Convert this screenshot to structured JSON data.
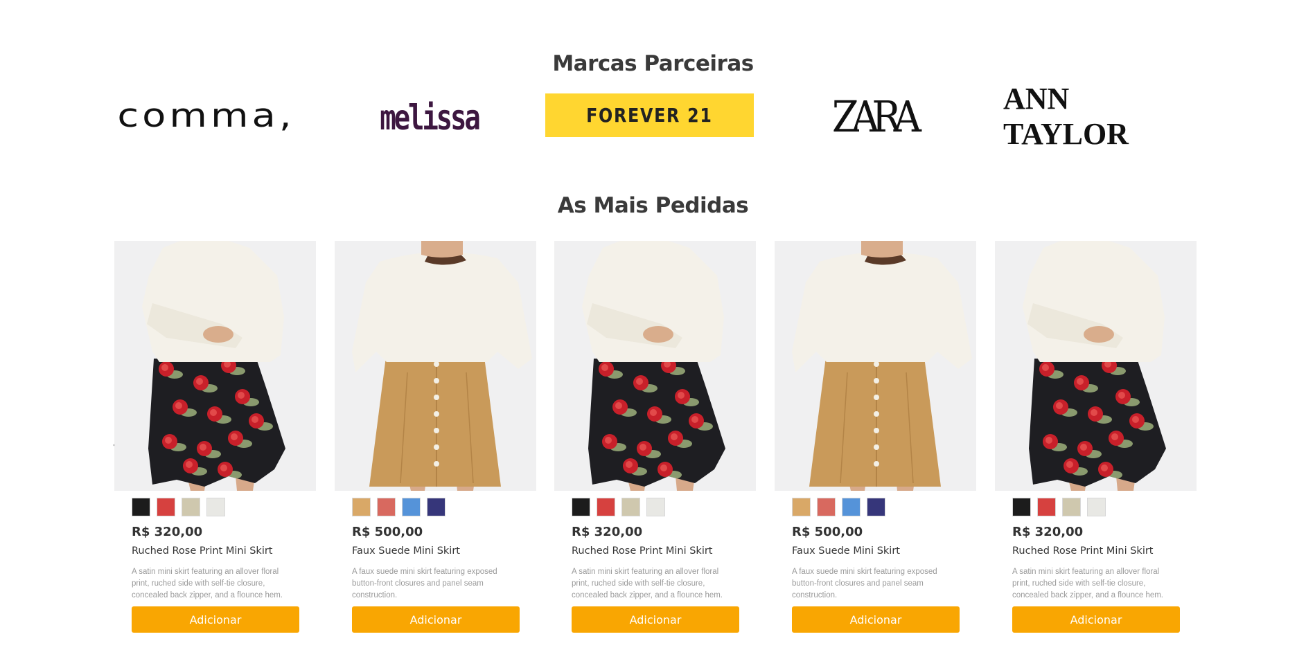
{
  "brands": {
    "title": "Marcas Parceiras",
    "items": [
      "comma,",
      "melissa",
      "FOREVER 21",
      "ZARA",
      "ANN TAYLOR"
    ],
    "forever21_bg": "#ffd630"
  },
  "best_sellers": {
    "title": "As Mais Pedidas",
    "add_label": "Adicionar",
    "accent": "#f9a602",
    "products": [
      {
        "price": "R$ 320,00",
        "name": "Ruched Rose Print Mini Skirt",
        "description": "A satin mini skirt featuring an allover floral print, ruched side with self-tie closure, concealed back zipper, and a flounce hem.",
        "colors": [
          "#1c1c1c",
          "#d6413f",
          "#cfc8ae",
          "#e8e8e4"
        ],
        "skirt": "floral"
      },
      {
        "price": "R$ 500,00",
        "name": "Faux Suede Mini Skirt",
        "description": "A faux suede mini skirt featuring exposed button-front closures and panel seam construction.",
        "colors": [
          "#d9a867",
          "#d8695f",
          "#5593d9",
          "#36367a"
        ],
        "skirt": "suede"
      },
      {
        "price": "R$ 320,00",
        "name": "Ruched Rose Print Mini Skirt",
        "description": "A satin mini skirt featuring an allover floral print, ruched side with self-tie closure, concealed back zipper, and a flounce hem.",
        "colors": [
          "#1c1c1c",
          "#d6413f",
          "#cfc8ae",
          "#e8e8e4"
        ],
        "skirt": "floral"
      },
      {
        "price": "R$ 500,00",
        "name": "Faux Suede Mini Skirt",
        "description": "A faux suede mini skirt featuring exposed button-front closures and panel seam construction.",
        "colors": [
          "#d9a867",
          "#d8695f",
          "#5593d9",
          "#36367a"
        ],
        "skirt": "suede"
      },
      {
        "price": "R$ 320,00",
        "name": "Ruched Rose Print Mini Skirt",
        "description": "A satin mini skirt featuring an allover floral print, ruched side with self-tie closure, concealed back zipper, and a flounce hem.",
        "colors": [
          "#1c1c1c",
          "#d6413f",
          "#cfc8ae",
          "#e8e8e4"
        ],
        "skirt": "floral"
      }
    ]
  },
  "icons": {
    "prev": "chevron-left-icon",
    "next": "chevron-right-icon"
  }
}
